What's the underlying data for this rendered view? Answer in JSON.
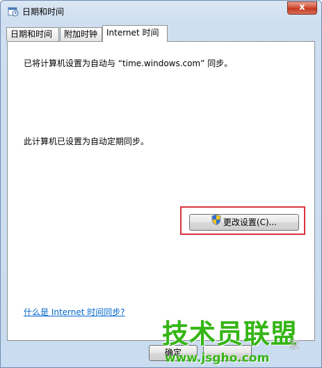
{
  "window": {
    "title": "日期和时间",
    "close_symbol": "x"
  },
  "tabs": [
    {
      "label": "日期和时间",
      "active": false
    },
    {
      "label": "附加时钟",
      "active": false
    },
    {
      "label": "Internet 时间",
      "active": true
    }
  ],
  "internet_time": {
    "sync_message": "已将计算机设置为自动与 “time.windows.com” 同步。",
    "schedule_message": "此计算机已设置为自动定期同步。",
    "change_button_label": "更改设置(C)...",
    "help_link": "什么是 Internet 时间同步?"
  },
  "footer": {
    "ok_label": "确定"
  },
  "watermark": {
    "main_text": "技术员联盟",
    "url_text": "www.jsgho.com",
    "corner_char": "家"
  },
  "colors": {
    "highlight_border": "#d9353c",
    "link": "#0066cc",
    "watermark": "#35b515"
  },
  "icons": [
    "clock-icon",
    "close-icon",
    "uac-shield-icon"
  ]
}
